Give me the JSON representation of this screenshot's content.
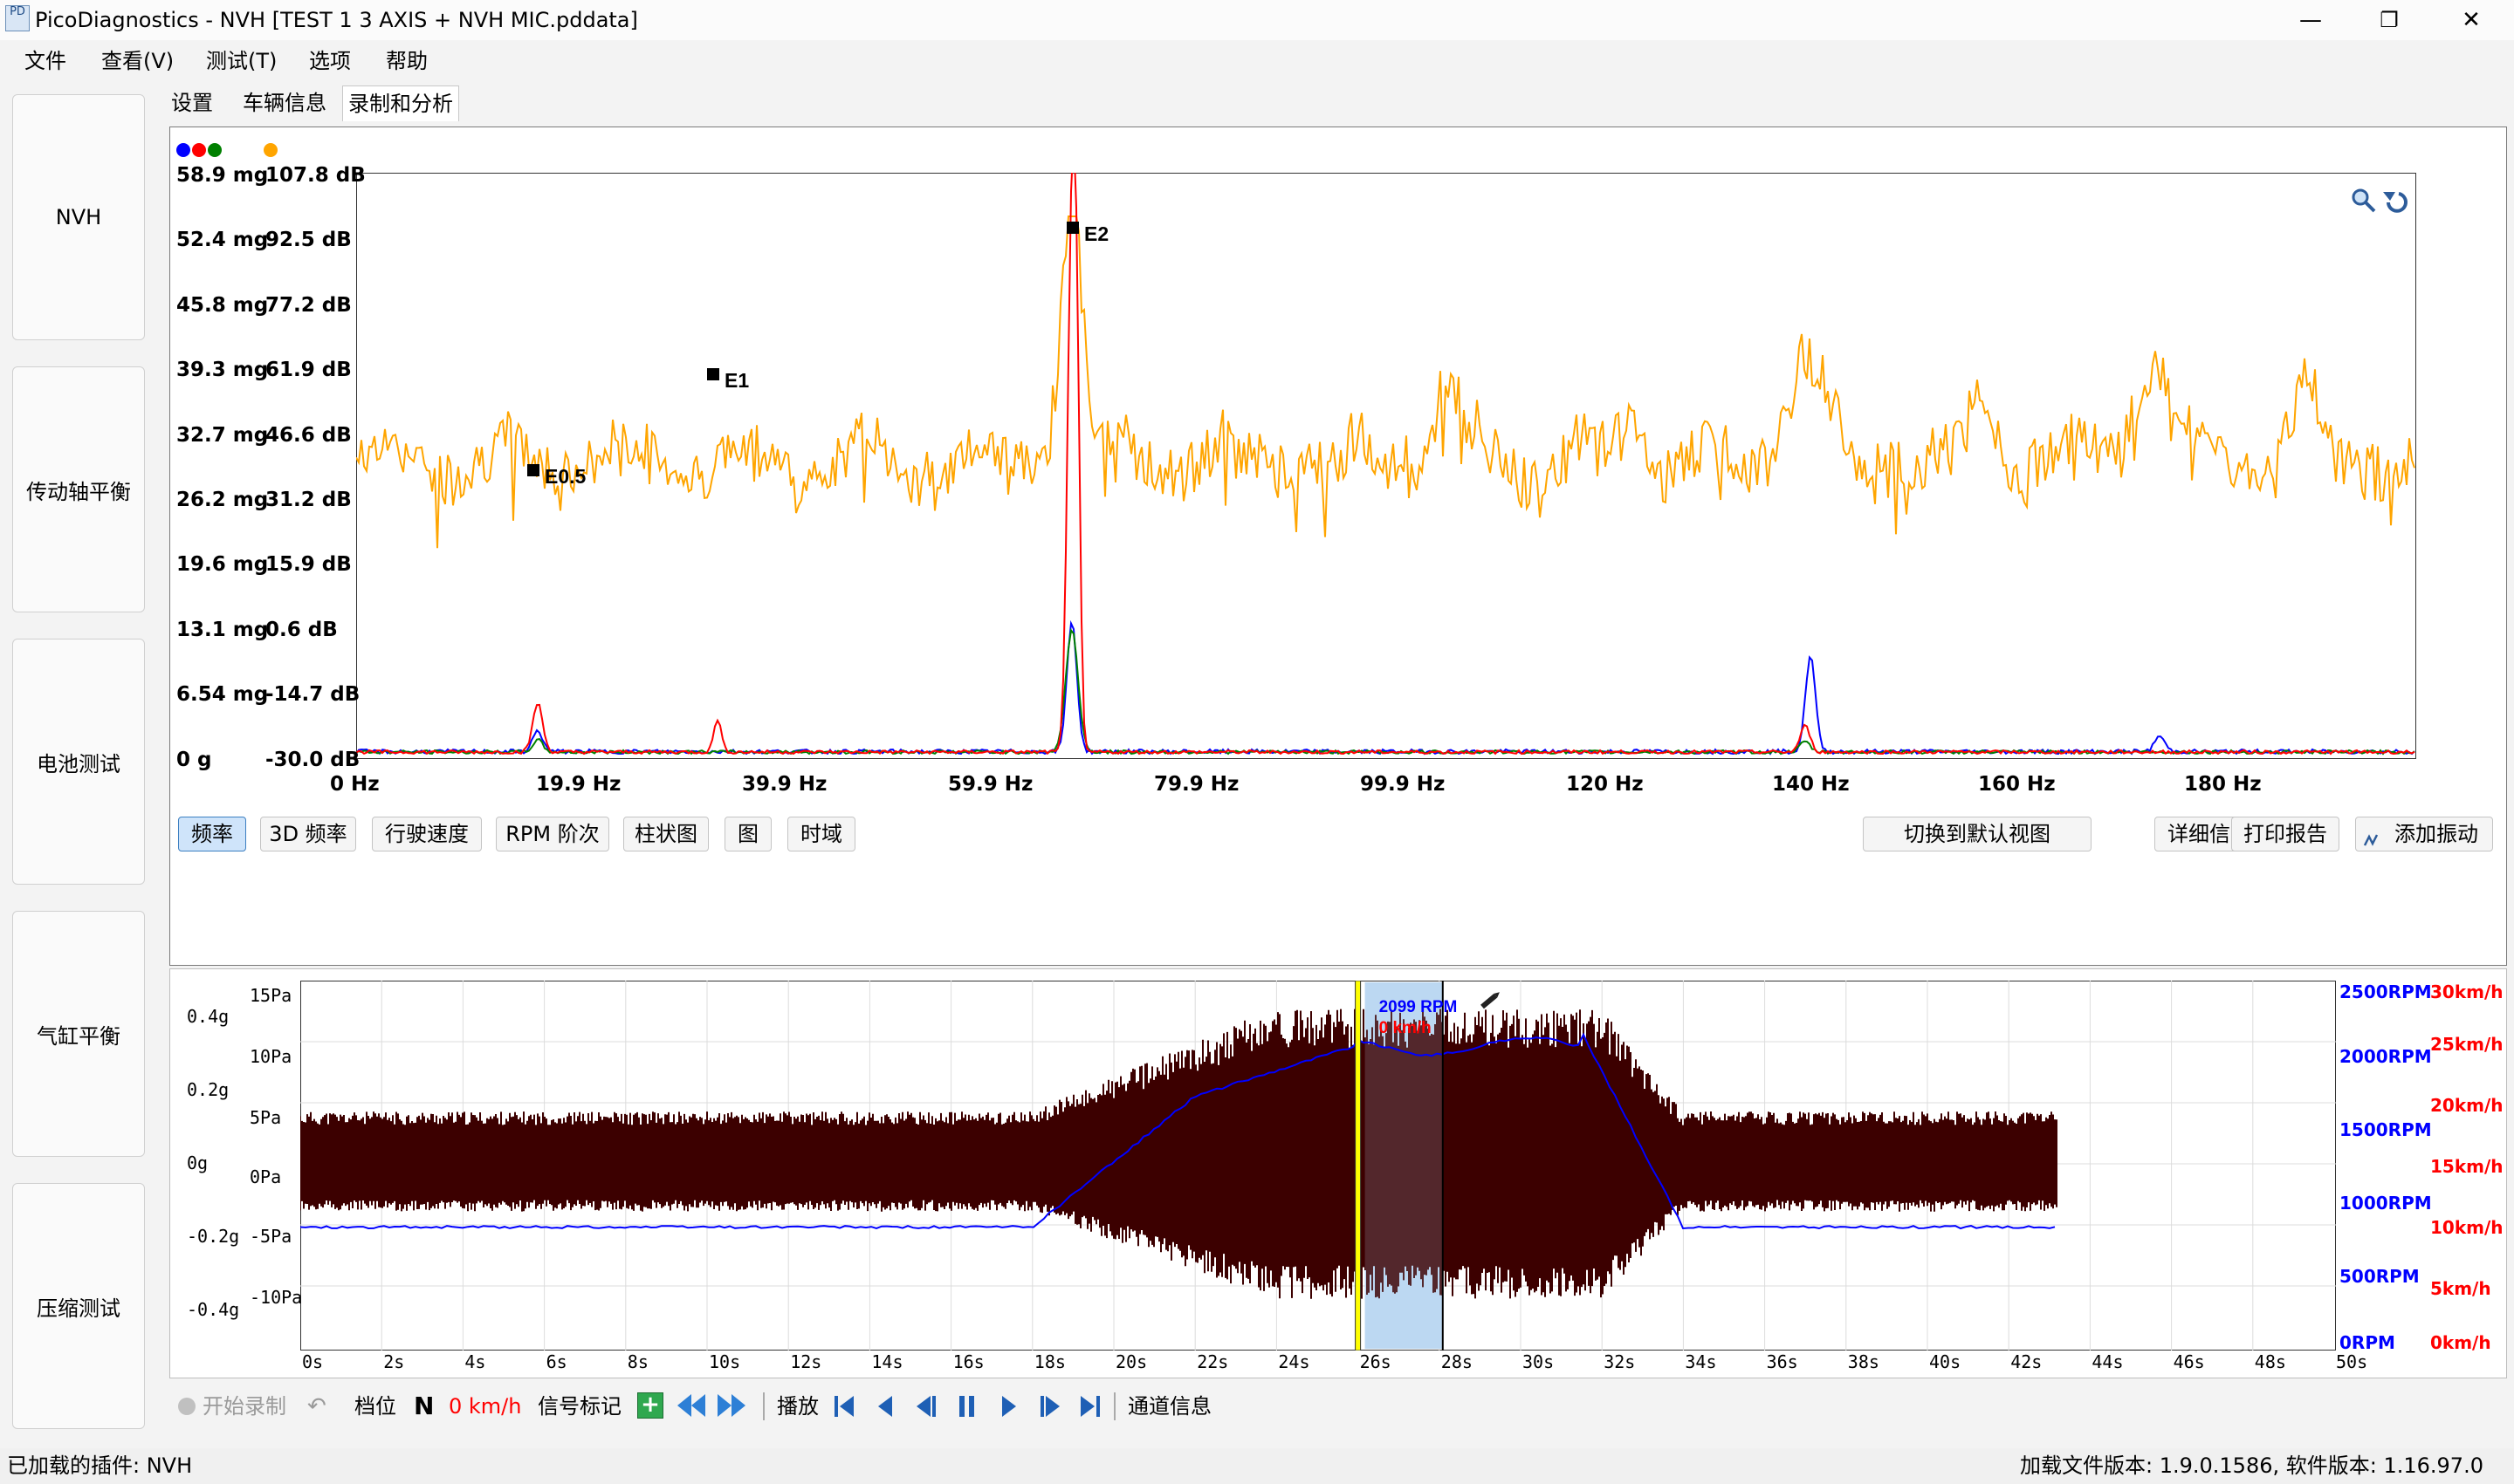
{
  "window": {
    "title": "PicoDiagnostics - NVH [TEST 1 3 AXIS + NVH MIC.pddata]",
    "app_icon_text": "PD",
    "minimize": "—",
    "restore": "❐",
    "close": "✕"
  },
  "menu": [
    "文件",
    "查看(V)",
    "测试(T)",
    "选项",
    "帮助"
  ],
  "left_nav": [
    "NVH",
    "传动轴平衡",
    "电池测试",
    "气缸平衡",
    "压缩测试"
  ],
  "tabs": [
    "设置",
    "车辆信息",
    "录制和分析"
  ],
  "spectrum": {
    "y_labels_mg": [
      "58.9 mg",
      "52.4 mg",
      "45.8 mg",
      "39.3 mg",
      "32.7 mg",
      "26.2 mg",
      "19.6 mg",
      "13.1 mg",
      "6.54 mg",
      "0 g"
    ],
    "y_labels_db": [
      "107.8 dB",
      "92.5 dB",
      "77.2 dB",
      "61.9 dB",
      "46.6 dB",
      "31.2 dB",
      "15.9 dB",
      "0.6 dB",
      "-14.7 dB",
      "-30.0 dB"
    ],
    "x_labels": [
      "0 Hz",
      "19.9 Hz",
      "39.9 Hz",
      "59.9 Hz",
      "79.9 Hz",
      "99.9 Hz",
      "120 Hz",
      "140 Hz",
      "160 Hz",
      "180 Hz"
    ],
    "markers": [
      "E0.5",
      "E1",
      "E2"
    ],
    "series_colors": {
      "x": "#ff0000",
      "y": "#0000ff",
      "z": "#008000",
      "mic": "#ffa500"
    },
    "zoom_icon": "magnifier-icon",
    "reset_icon": "undo-icon"
  },
  "view_buttons": [
    "频率",
    "3D 频率",
    "行驶速度",
    "RPM 阶次",
    "柱状图",
    "图",
    "时域"
  ],
  "right_buttons": [
    "切换到默认视图",
    "详细信息",
    "打印报告",
    "添加振动"
  ],
  "timeline": {
    "y_left_g": [
      "0.4g",
      "0.2g",
      "0g",
      "-0.2g",
      "-0.4g"
    ],
    "y_left_pa": [
      "15Pa",
      "10Pa",
      "5Pa",
      "0Pa",
      "-5Pa",
      "-10Pa"
    ],
    "y_right_rpm": [
      "2500RPM",
      "2000RPM",
      "1500RPM",
      "1000RPM",
      "500RPM",
      "0RPM"
    ],
    "y_right_kmh": [
      "30km/h",
      "25km/h",
      "20km/h",
      "15km/h",
      "10km/h",
      "5km/h",
      "0km/h"
    ],
    "x_labels": [
      "0s",
      "2s",
      "4s",
      "6s",
      "8s",
      "10s",
      "12s",
      "14s",
      "16s",
      "18s",
      "20s",
      "22s",
      "24s",
      "26s",
      "28s",
      "30s",
      "32s",
      "34s",
      "36s",
      "38s",
      "40s",
      "42s",
      "44s",
      "46s",
      "48s",
      "50s"
    ],
    "cursor_rpm": "2099 RPM",
    "cursor_speed": "0 km/h",
    "colors": {
      "signal": "#3c0000",
      "rpm": "#0000ff",
      "cursor": "#ffff00",
      "selection": "#bcd8f2"
    }
  },
  "bottom": {
    "record": "开始录制",
    "gear_label": "档位",
    "gear_value": "N",
    "speed": "0 km/h",
    "signal_marker": "信号标记",
    "play_label": "播放",
    "channel_info": "通道信息"
  },
  "status": {
    "left": "已加载的插件: NVH",
    "right": "加载文件版本: 1.9.0.1586, 软件版本:   1.16.97.0"
  }
}
